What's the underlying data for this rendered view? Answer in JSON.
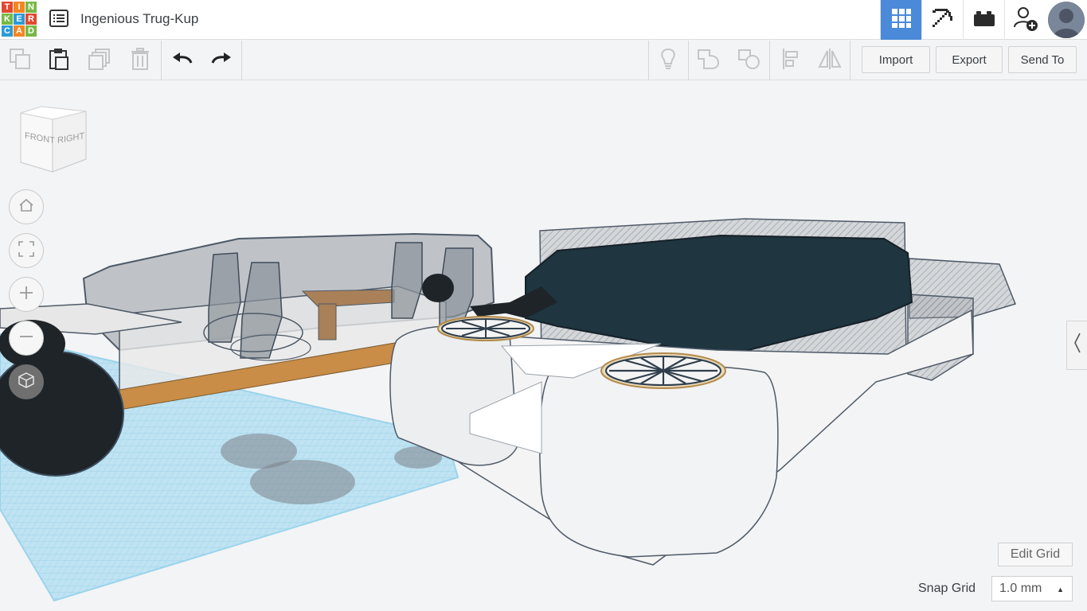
{
  "app": {
    "logo_letters": [
      "T",
      "I",
      "N",
      "K",
      "E",
      "R",
      "C",
      "A",
      "D"
    ],
    "design_title": "Ingenious Trug-Kup"
  },
  "topbar": {
    "views": [
      {
        "name": "3d-design-grid-icon",
        "active": true
      },
      {
        "name": "pickaxe-icon",
        "active": false
      },
      {
        "name": "bricks-icon",
        "active": false
      },
      {
        "name": "add-user-icon",
        "active": false
      }
    ]
  },
  "toolbar": {
    "import_label": "Import",
    "export_label": "Export",
    "send_to_label": "Send To"
  },
  "viewcube": {
    "front_label": "FRONT",
    "right_label": "RIGHT"
  },
  "workplane": {
    "edit_grid_label": "Edit Grid",
    "snap_grid_label": "Snap Grid",
    "snap_grid_value": "1.0 mm"
  },
  "colors": {
    "accent": "#4a8ad8",
    "logo_red": "#e2492f",
    "logo_orange": "#f48521",
    "logo_green": "#77b944",
    "logo_blue": "#2c9ad6",
    "grid_blue": "#a9d9ee"
  }
}
